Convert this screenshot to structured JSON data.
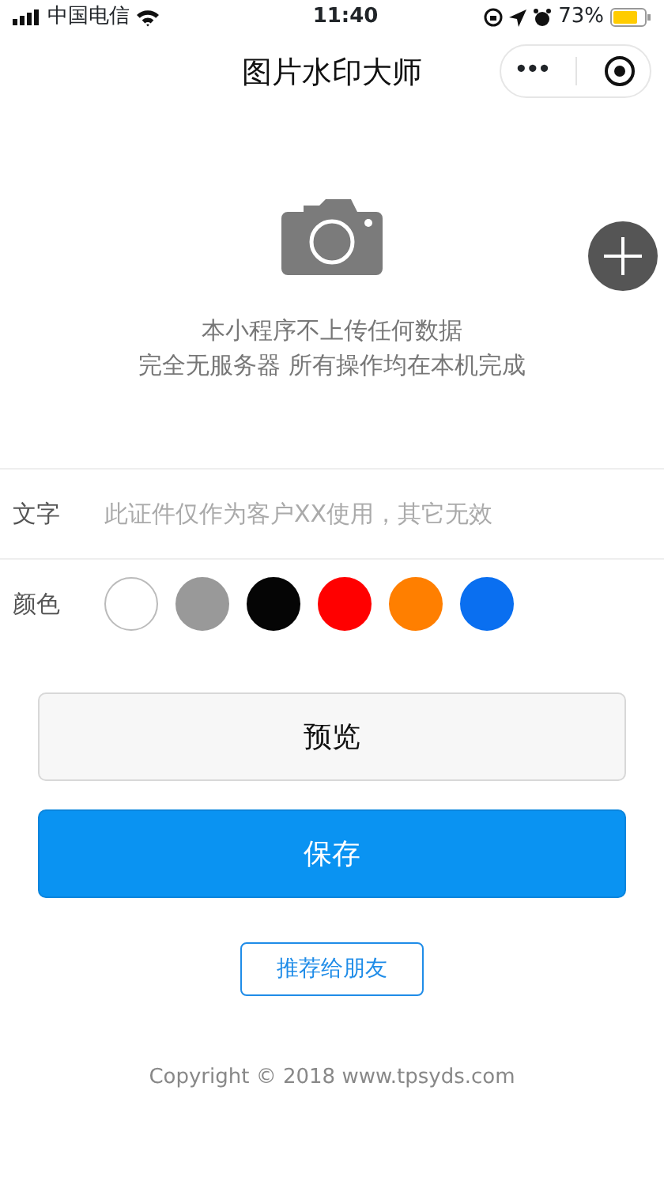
{
  "status_bar": {
    "carrier": "中国电信",
    "time": "11:40",
    "battery": "73%"
  },
  "nav": {
    "title": "图片水印大师",
    "more": "•••"
  },
  "intro": [
    "本小程序不上传任何数据",
    "完全无服务器 所有操作均在本机完成"
  ],
  "text_row": {
    "label": "文字",
    "placeholder": "此证件仅作为客户XX使用，其它无效"
  },
  "color_row": {
    "label": "颜色",
    "swatches": [
      {
        "color": "#ffffff",
        "selected": false
      },
      {
        "color": "#999999",
        "selected": false
      },
      {
        "color": "#050505",
        "selected": false
      },
      {
        "color": "#ff0000",
        "selected": false
      },
      {
        "color": "#ff7f00",
        "selected": false
      },
      {
        "color": "#0a6ff0",
        "selected": false
      }
    ]
  },
  "buttons": {
    "preview": "预览",
    "save": "保存",
    "share": "推荐给朋友"
  },
  "footer": "Copyright © 2018 www.tpsyds.com"
}
